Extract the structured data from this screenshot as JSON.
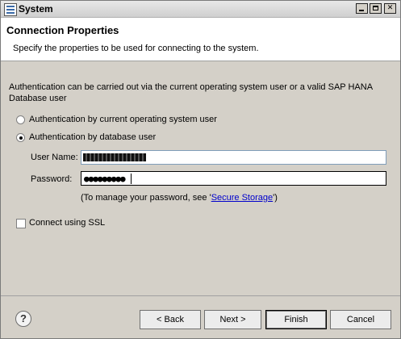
{
  "window": {
    "title": "System"
  },
  "header": {
    "title": "Connection Properties",
    "description": "Specify the properties to be used for connecting to the system."
  },
  "auth": {
    "intro": "Authentication can be carried out via the current operating system user or a valid SAP HANA Database user",
    "option_os_user": "Authentication by current operating system user",
    "option_db_user": "Authentication by database user",
    "selected": "Authentication by database user"
  },
  "fields": {
    "user_name_label": "User Name:",
    "password_label": "Password:",
    "password_value": "●●●●●●●●●"
  },
  "manage_note": {
    "prefix": "(To manage your password, see '",
    "link": "Secure Storage",
    "suffix": "')"
  },
  "ssl": {
    "label": "Connect using SSL",
    "checked": false
  },
  "footer": {
    "help_label": "?",
    "back_label": "< Back",
    "next_label": "Next >",
    "finish_label": "Finish",
    "cancel_label": "Cancel"
  },
  "colors": {
    "dialog_bg": "#d4d0c8",
    "header_bg": "#ffffff",
    "link": "#0000cc"
  }
}
